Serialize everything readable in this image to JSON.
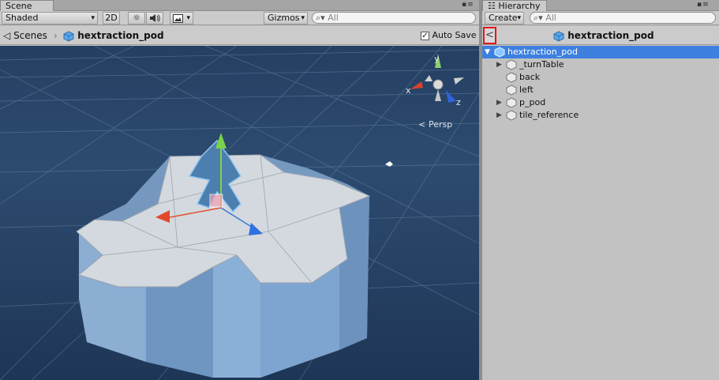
{
  "scene": {
    "tab_label": "Scene",
    "shading_mode": "Shaded",
    "mode_2d": "2D",
    "gizmos_label": "Gizmos",
    "search_placeholder": "All",
    "breadcrumb_root": "Scenes",
    "breadcrumb_prefab": "hextraction_pod",
    "auto_save_label": "Auto Save",
    "auto_save_checked": true,
    "projection_label": "Persp",
    "axis_labels": {
      "x": "x",
      "y": "y",
      "z": "z"
    }
  },
  "hierarchy": {
    "tab_label": "Hierarchy",
    "create_label": "Create",
    "search_placeholder": "All",
    "header_title": "hextraction_pod",
    "back_label": "<",
    "items": [
      {
        "label": "hextraction_pod",
        "depth": 0,
        "expanded": true,
        "has_children": true,
        "selected": true
      },
      {
        "label": "_turnTable",
        "depth": 1,
        "has_children": true,
        "selected": false
      },
      {
        "label": "back",
        "depth": 1,
        "has_children": false,
        "selected": false
      },
      {
        "label": "left",
        "depth": 1,
        "has_children": false,
        "selected": false
      },
      {
        "label": "p_pod",
        "depth": 1,
        "has_children": true,
        "selected": false
      },
      {
        "label": "tile_reference",
        "depth": 1,
        "has_children": true,
        "selected": false
      }
    ]
  },
  "colors": {
    "selection": "#3d80df",
    "viewport_sky": "#2c4a6e",
    "highlight_box": "#e0161a"
  }
}
